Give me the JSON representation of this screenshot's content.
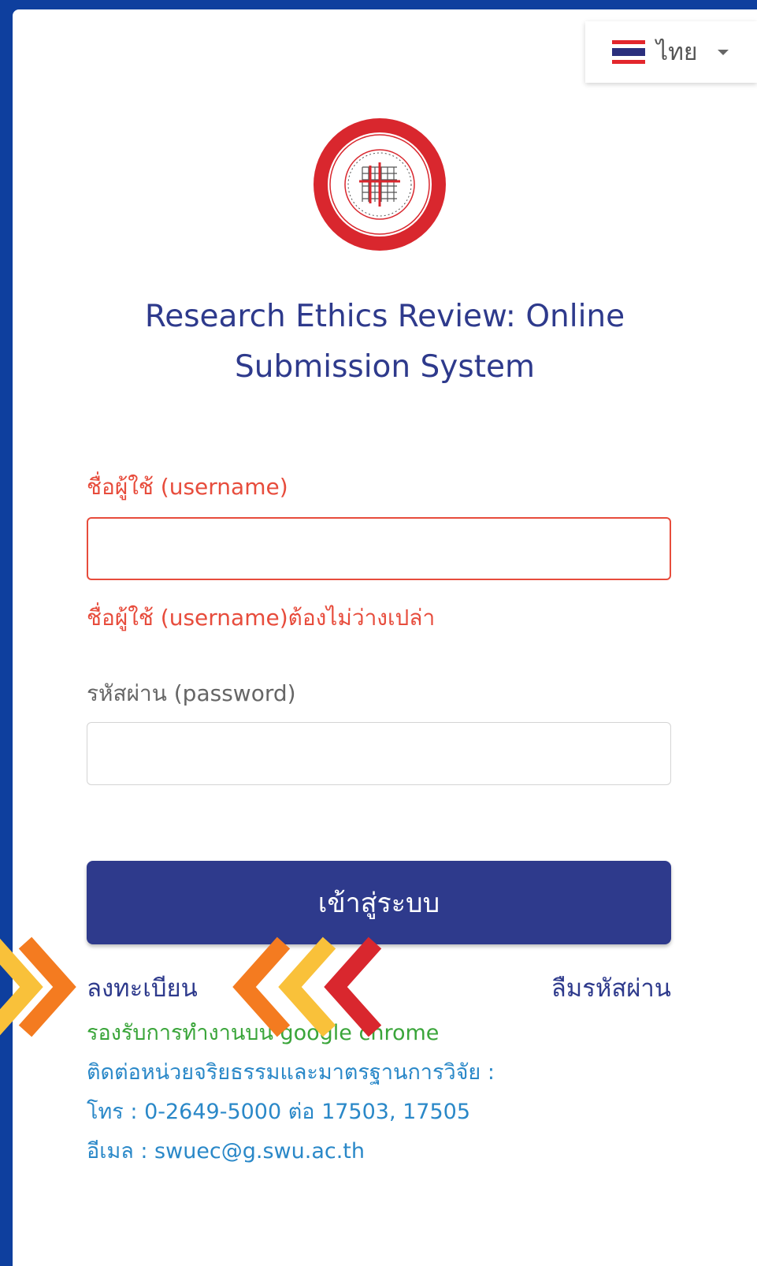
{
  "language": {
    "flag": "thai-flag-icon",
    "label": "ไทย"
  },
  "title": {
    "line1": "Research Ethics Review: Online",
    "line2": "Submission System"
  },
  "username": {
    "label": "ชื่อผู้ใช้ (username)",
    "value": "",
    "error": "ชื่อผู้ใช้ (username)ต้องไม่ว่างเปล่า"
  },
  "password": {
    "label": "รหัสผ่าน (password)",
    "value": ""
  },
  "login_button": "เข้าสู่ระบบ",
  "register_link": "ลงทะเบียน",
  "forgot_link": "ลืมรหัสผ่าน",
  "info": {
    "browser_note": "รองรับการทำงานบน google chrome",
    "contact": "ติดต่อหน่วยจริยธรรมและมาตรฐานการวิจัย :",
    "phone": "โทร : 0-2649-5000 ต่อ 17503, 17505",
    "email": "อีเมล : swuec@g.swu.ac.th"
  },
  "colors": {
    "primary": "#2e3a8c",
    "error": "#e74c3c",
    "success": "#3aa53a",
    "info": "#2a88c8",
    "background": "#0e3f9e"
  }
}
